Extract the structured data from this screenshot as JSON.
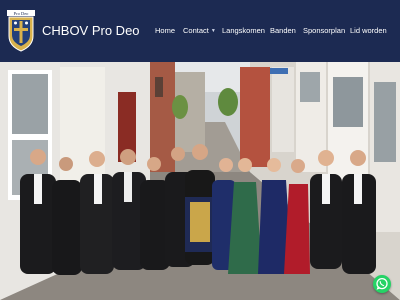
{
  "header": {
    "logo_icon": "chbov-crest-icon",
    "logo_motto": "Pro Deo",
    "site_title": "CHBOV Pro Deo"
  },
  "nav": {
    "items": [
      {
        "label": "Home",
        "has_dropdown": false
      },
      {
        "label": "Contact",
        "has_dropdown": true
      },
      {
        "label": "Langskomen",
        "has_dropdown": false
      },
      {
        "label": "Banden",
        "has_dropdown": false
      },
      {
        "label": "Sponsorplan",
        "has_dropdown": false
      },
      {
        "label": "Lid worden",
        "has_dropdown": false
      }
    ]
  },
  "hero": {
    "image_icon": "group-photo-street-icon"
  },
  "floating": {
    "whatsapp_icon": "whatsapp-icon"
  },
  "colors": {
    "header_bg": "#1c2a52",
    "nav_text": "#ffffff",
    "whatsapp": "#25d366"
  }
}
